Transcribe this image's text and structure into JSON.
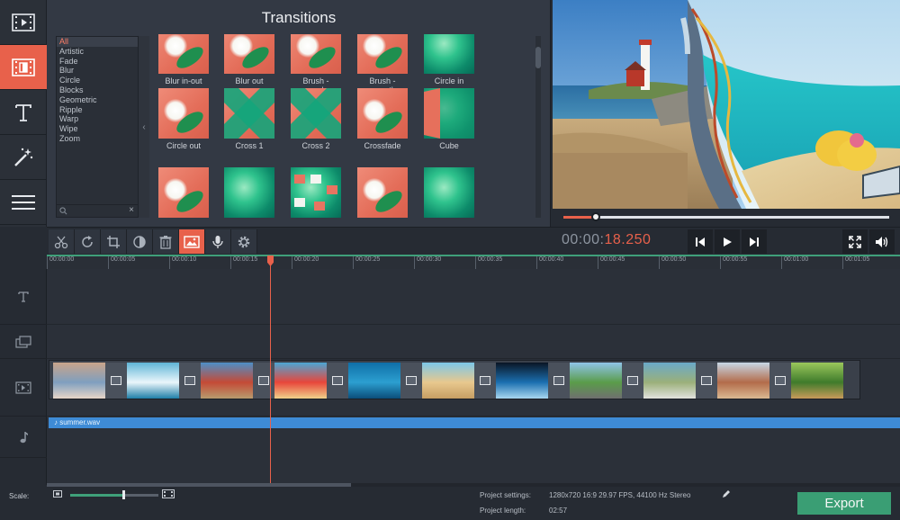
{
  "sidebar": {
    "items": [
      {
        "icon": "film-import-icon",
        "active": false
      },
      {
        "icon": "transitions-icon",
        "active": true
      },
      {
        "icon": "text-icon",
        "active": false
      },
      {
        "icon": "magic-wand-icon",
        "active": false
      },
      {
        "icon": "hamburger-menu-icon",
        "active": false
      }
    ]
  },
  "transitions": {
    "title": "Transitions",
    "categories": [
      "All",
      "Artistic",
      "Fade",
      "Blur",
      "Circle",
      "Blocks",
      "Geometric",
      "Ripple",
      "Warp",
      "Wipe",
      "Zoom"
    ],
    "selected_category": "All",
    "search_placeholder": "",
    "search_clear": "×",
    "collapse_glyph": "‹",
    "items": [
      {
        "label": "Blur in-out"
      },
      {
        "label": "Blur out"
      },
      {
        "label": "Brush -\nrough"
      },
      {
        "label": "Brush -\nsmooth"
      },
      {
        "label": "Circle in"
      },
      {
        "label": "Circle out"
      },
      {
        "label": "Cross 1"
      },
      {
        "label": "Cross 2"
      },
      {
        "label": "Crossfade"
      },
      {
        "label": "Cube"
      },
      {
        "label": ""
      },
      {
        "label": ""
      },
      {
        "label": ""
      },
      {
        "label": ""
      },
      {
        "label": ""
      }
    ]
  },
  "preview": {
    "progress": 0.1
  },
  "toolbar": {
    "tools": [
      "scissors-icon",
      "rotate-icon",
      "crop-icon",
      "color-adjust-icon",
      "trash-icon",
      "image-icon",
      "microphone-icon",
      "gear-icon"
    ],
    "active_tool": "image-icon",
    "timecode_prefix": "00:00:",
    "timecode_suffix": "18.250"
  },
  "ruler": {
    "ticks": [
      "00:00:00",
      "00:00:05",
      "00:00:10",
      "00:00:15",
      "00:00:20",
      "00:00:25",
      "00:00:30",
      "00:00:35",
      "00:00:40",
      "00:00:45",
      "00:00:50",
      "00:00:55",
      "00:01:00",
      "00:01:05"
    ]
  },
  "tracks": {
    "audio_clip": "summer.wav",
    "video_clips": [
      {
        "scene": "couple"
      },
      {
        "scene": "surf"
      },
      {
        "scene": "lighthouse"
      },
      {
        "scene": "beach-umbrellas"
      },
      {
        "scene": "underwater"
      },
      {
        "scene": "sandy-beach"
      },
      {
        "scene": "ocean-horizon"
      },
      {
        "scene": "road"
      },
      {
        "scene": "boats"
      },
      {
        "scene": "couple-beach"
      },
      {
        "scene": "park-path"
      }
    ]
  },
  "footer": {
    "scale_label": "Scale:",
    "scale_value": 0.6,
    "project_settings_label": "Project settings:",
    "project_settings_value": "1280x720 16:9 29.97 FPS, 44100 Hz Stereo",
    "project_length_label": "Project length:",
    "project_length_value": "02:57",
    "export_label": "Export"
  },
  "colors": {
    "accent": "#e8614b",
    "export_green": "#3a9e74",
    "audio_blue": "#3e8bd6",
    "background": "#262b33"
  }
}
